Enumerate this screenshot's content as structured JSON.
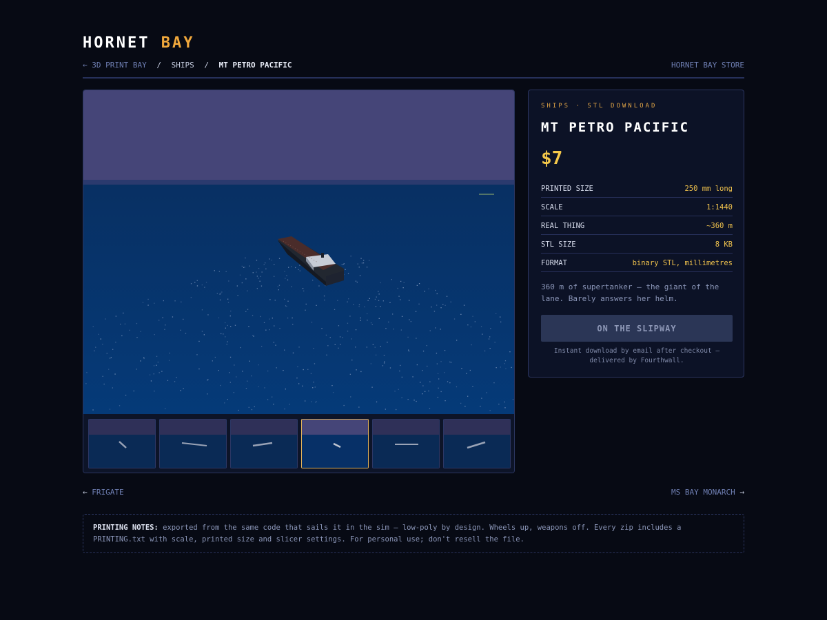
{
  "brand": {
    "name": "HORNET",
    "accent": "BAY"
  },
  "breadcrumb": {
    "back": "← 3D PRINT BAY",
    "separator": "/",
    "category": "SHIPS",
    "current": "MT PETRO PACIFIC",
    "store": "HORNET BAY STORE"
  },
  "product": {
    "eyebrow": "SHIPS · STL DOWNLOAD",
    "title": "MT PETRO PACIFIC",
    "price": "$7",
    "specs": [
      {
        "label": "PRINTED SIZE",
        "value": "250 mm long"
      },
      {
        "label": "SCALE",
        "value": "1:1440"
      },
      {
        "label": "REAL THING",
        "value": "~360 m"
      },
      {
        "label": "STL SIZE",
        "value": "8 KB"
      },
      {
        "label": "FORMAT",
        "value": "binary STL, millimetres"
      }
    ],
    "description": "360 m of supertanker — the giant of the lane. Barely answers her helm.",
    "cta_label": "ON THE SLIPWAY",
    "delivery_note": "Instant download by email after checkout — delivered by Fourthwall."
  },
  "gallery": {
    "thumbnail_count": 6,
    "active_index": 3
  },
  "nav": {
    "prev_label": "FRIGATE",
    "prev_arrow": "←",
    "next_label": "MS BAY MONARCH",
    "next_arrow": "→"
  },
  "notes": {
    "label": "PRINTING NOTES:",
    "text": "exported from the same code that sails it in the sim — low-poly by design. Wheels up, weapons off. Every zip includes a PRINTING.txt with scale, printed size and slicer settings. For personal use; don't resell the file."
  },
  "colors": {
    "background": "#070a14",
    "accent": "#f0a83c",
    "price": "#f5c84a",
    "link": "#6f7fb3",
    "sky": "#454578",
    "sea": "#073067"
  }
}
